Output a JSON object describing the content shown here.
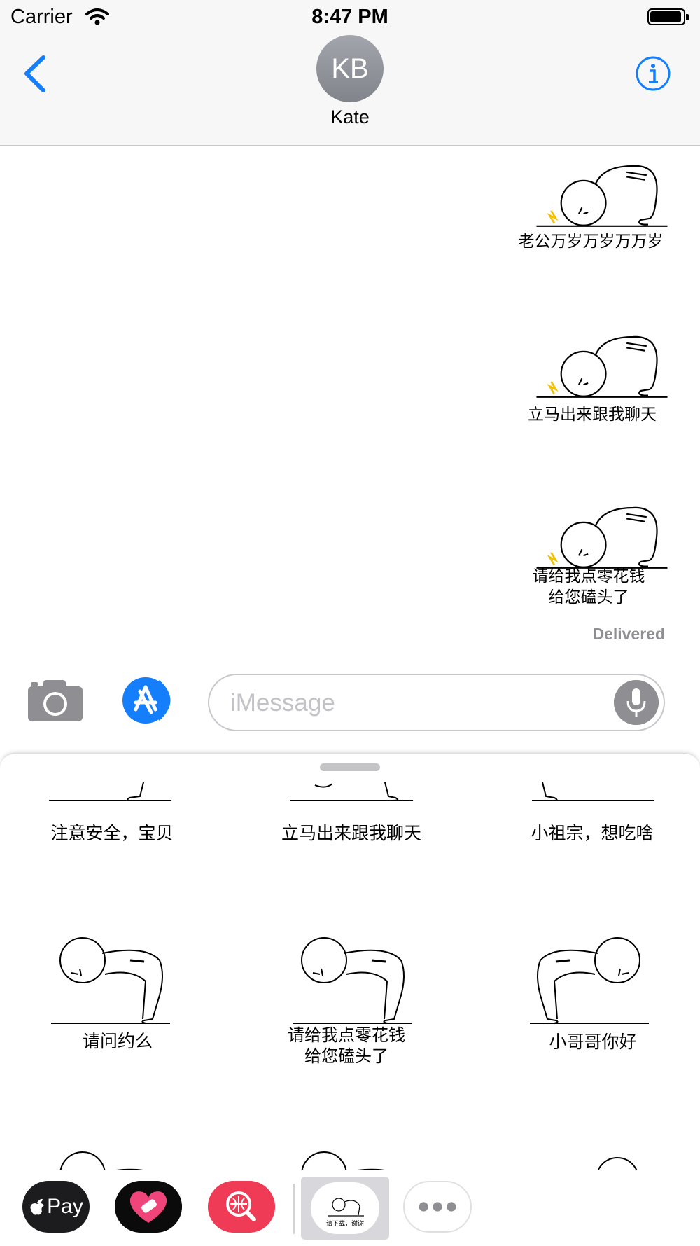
{
  "status_bar": {
    "carrier": "Carrier",
    "time": "8:47 PM"
  },
  "header": {
    "avatar_initials": "KB",
    "contact_name": "Kate"
  },
  "conversation": {
    "stickers": [
      {
        "caption_lines": [
          "老公万岁万岁万万岁"
        ]
      },
      {
        "caption_lines": [
          "立马出来跟我聊天"
        ]
      },
      {
        "caption_lines": [
          "请给我点零花钱",
          "给您磕头了"
        ]
      }
    ],
    "delivered": "Delivered"
  },
  "composer": {
    "placeholder": "iMessage"
  },
  "drawer": {
    "row1_captions": [
      "注意安全，宝贝",
      "立马出来跟我聊天",
      "小祖宗，想吃啥"
    ],
    "row2": [
      {
        "caption_lines": [
          "请问约么"
        ]
      },
      {
        "caption_lines": [
          "请给我点零花钱",
          "给您磕头了"
        ]
      },
      {
        "caption_lines": [
          "小哥哥你好"
        ]
      }
    ]
  },
  "dock": {
    "apple_pay_label": "Pay",
    "selected_app_label": "请下载，谢谢"
  },
  "colors": {
    "ios_blue": "#147efb",
    "delivered_gray": "#8e8e93",
    "header_bg": "#f7f7f7"
  },
  "icons": [
    "wifi-icon",
    "battery-icon",
    "back-chevron-icon",
    "info-icon",
    "camera-icon",
    "app-store-icon",
    "microphone-icon",
    "apple-logo-icon",
    "more-icon"
  ]
}
